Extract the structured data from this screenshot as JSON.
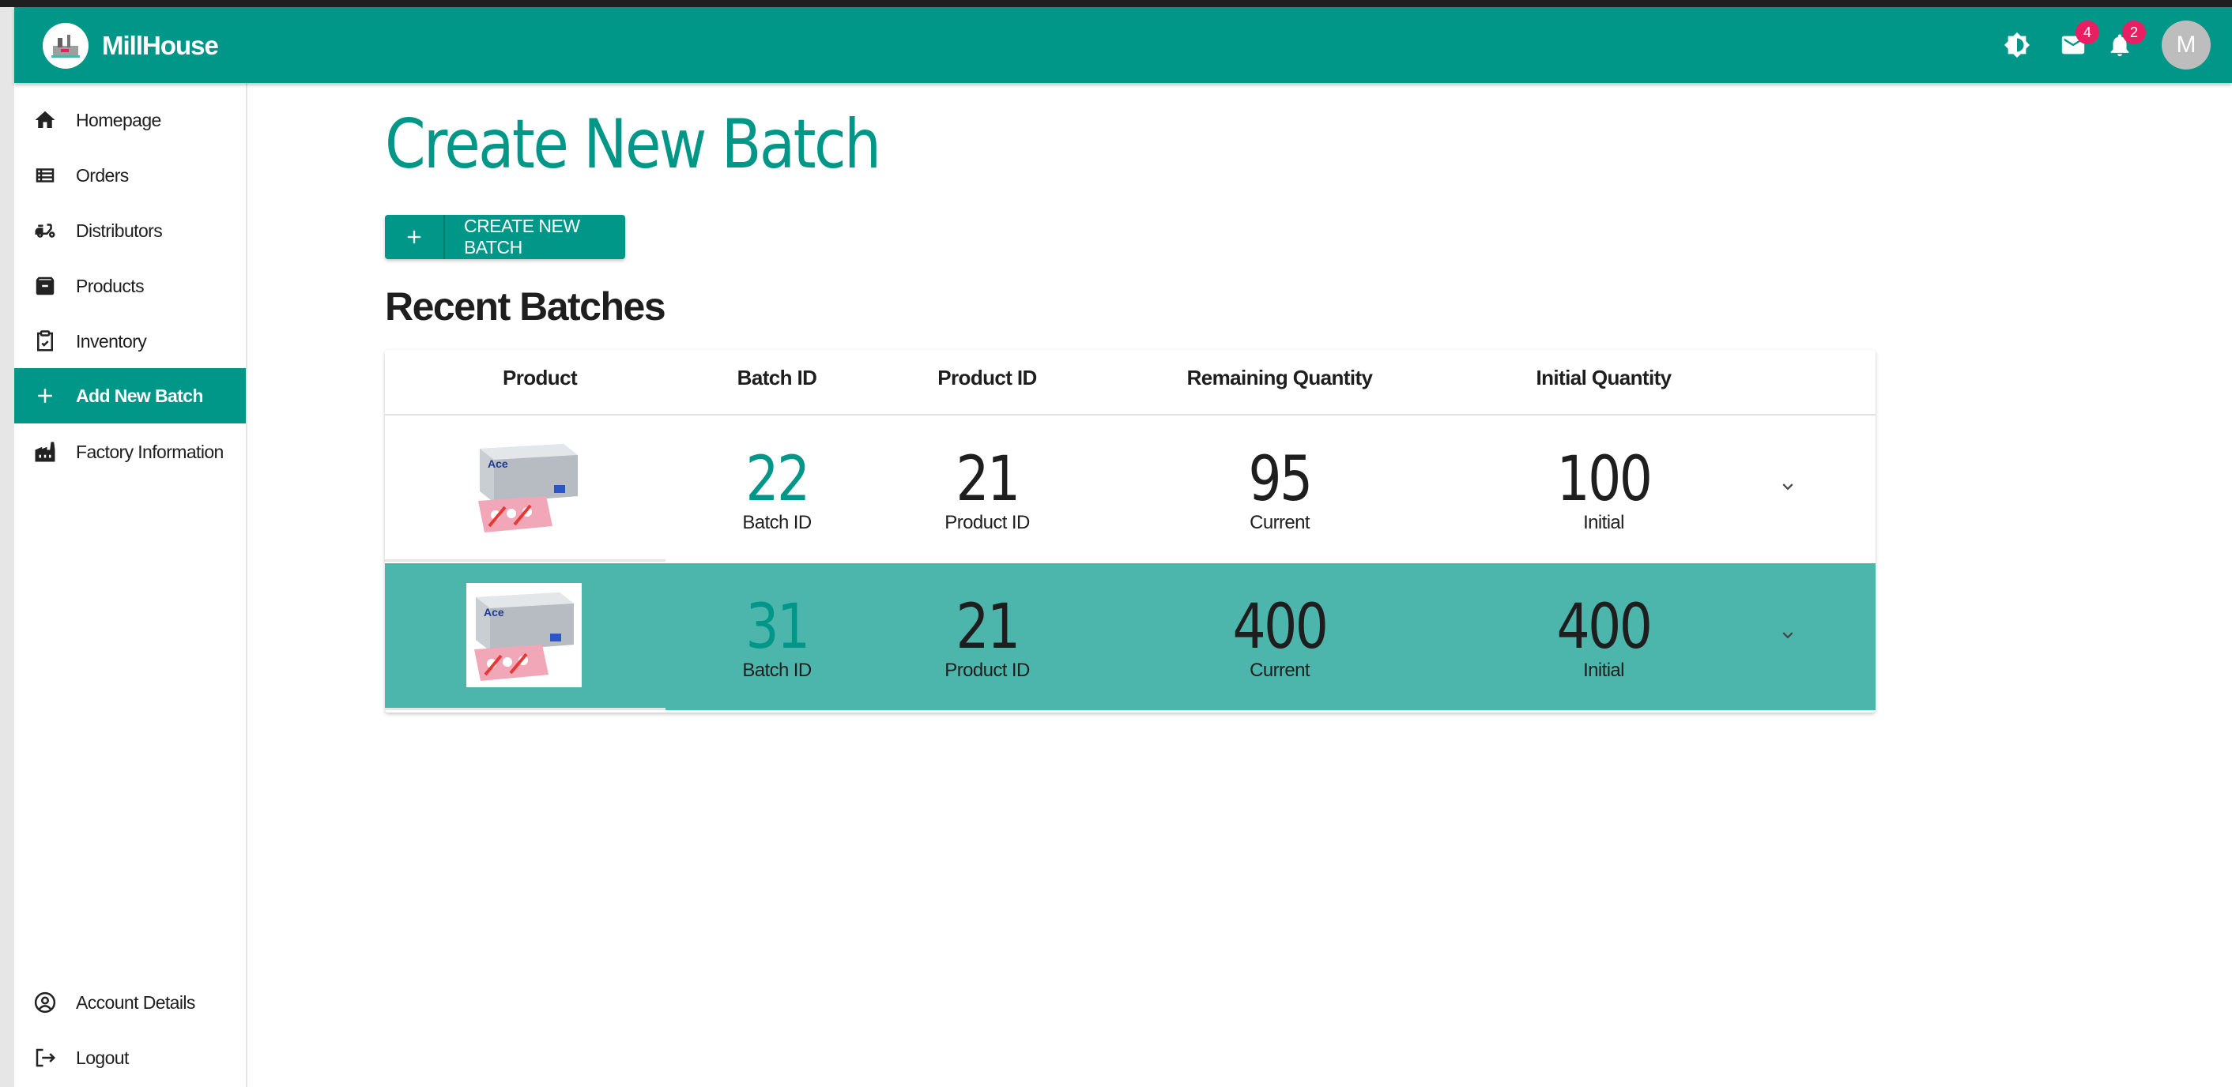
{
  "app": {
    "title": "MillHouse",
    "avatar_letter": "M"
  },
  "appbar": {
    "theme_icon": "brightness-icon",
    "mail": {
      "icon": "mail-icon",
      "count": "4"
    },
    "notifications": {
      "icon": "bell-icon",
      "count": "2"
    }
  },
  "sidebar": {
    "items": [
      {
        "label": "Homepage",
        "icon": "home-icon"
      },
      {
        "label": "Orders",
        "icon": "list-icon"
      },
      {
        "label": "Distributors",
        "icon": "scooter-icon"
      },
      {
        "label": "Products",
        "icon": "archive-icon"
      },
      {
        "label": "Inventory",
        "icon": "clipboard-check-icon"
      },
      {
        "label": "Add New Batch",
        "icon": "plus-icon",
        "active": true
      },
      {
        "label": "Factory Information",
        "icon": "factory-icon"
      }
    ],
    "bottom_items": [
      {
        "label": "Account Details",
        "icon": "account-circle-icon"
      },
      {
        "label": "Logout",
        "icon": "logout-icon"
      }
    ]
  },
  "main": {
    "title": "Create New Batch",
    "create_button_label": "CREATE NEW BATCH",
    "recent_title": "Recent Batches"
  },
  "table": {
    "columns": [
      "Product",
      "Batch ID",
      "Product ID",
      "Remaining Quantity",
      "Initial Quantity"
    ],
    "rows": [
      {
        "product_image": "Ace product box",
        "batch_id": "22",
        "batch_caption": "Batch ID",
        "product_id": "21",
        "product_caption": "Product ID",
        "remaining": "95",
        "remaining_caption": "Current",
        "initial": "100",
        "initial_caption": "Initial"
      },
      {
        "product_image": "Ace product box",
        "batch_id": "31",
        "batch_caption": "Batch ID",
        "product_id": "21",
        "product_caption": "Product ID",
        "remaining": "400",
        "remaining_caption": "Current",
        "initial": "400",
        "initial_caption": "Initial"
      }
    ]
  },
  "colors": {
    "primary": "#009688",
    "highlight_row": "#4db6ac",
    "badge": "#e91e63"
  }
}
